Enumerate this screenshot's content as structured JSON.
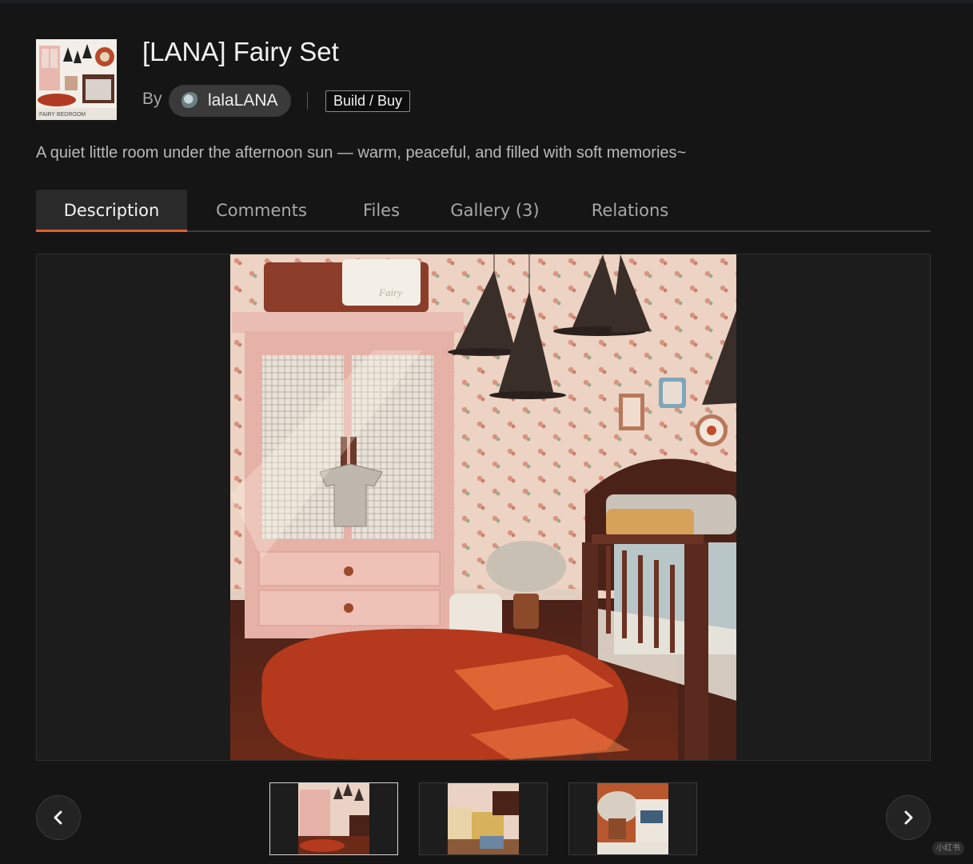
{
  "item": {
    "title": "[LANA] Fairy Set",
    "by_label": "By",
    "author": "lalaLANA",
    "category": "Build / Buy",
    "tagline": "A quiet little room under the afternoon sun — warm, peaceful, and filled with soft memories~",
    "thumbnail_caption": "FAIRY BEDROOM"
  },
  "tabs": [
    {
      "label": "Description",
      "active": true
    },
    {
      "label": "Comments",
      "active": false
    },
    {
      "label": "Files",
      "active": false
    },
    {
      "label": "Gallery (3)",
      "active": false
    },
    {
      "label": "Relations",
      "active": false
    }
  ],
  "gallery": {
    "selected_index": 0,
    "image_sign_text": "Fairy",
    "thumbnails": [
      "pink-wardrobe-bedroom",
      "yellow-desk-bedroom",
      "flower-bed-closeup"
    ]
  },
  "colors": {
    "accent": "#e0602a",
    "background": "#151515",
    "tab_active_bg": "#2a2a2a"
  },
  "icons": {
    "prev": "chevron-left-icon",
    "next": "chevron-right-icon"
  },
  "watermark": "小红书"
}
